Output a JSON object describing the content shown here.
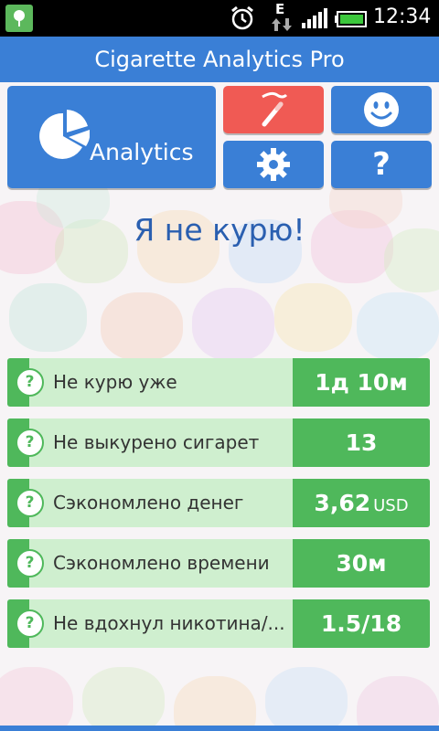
{
  "status_bar": {
    "time": "12:34",
    "network_type": "E",
    "icons": [
      "app-tree-icon",
      "alarm-clock-icon",
      "data-arrows-icon",
      "signal-icon",
      "battery-icon"
    ]
  },
  "app": {
    "title": "Cigarette Analytics Pro"
  },
  "toolbar": {
    "analytics_label": "Analytics",
    "help_label": "?"
  },
  "main": {
    "headline": "Я не курю!"
  },
  "stats": [
    {
      "label": "Не курю уже",
      "value": "1д 10м",
      "unit": ""
    },
    {
      "label": "Не выкурено сигарет",
      "value": "13",
      "unit": ""
    },
    {
      "label": "Сэкономлено денег",
      "value": "3,62",
      "unit": "USD"
    },
    {
      "label": "Сэкономлено времени",
      "value": "30м",
      "unit": ""
    },
    {
      "label": "Не вдохнул никотина/...",
      "value": "1.5/18",
      "unit": ""
    }
  ],
  "help_icon_text": "?",
  "colors": {
    "primary_blue": "#3a7fd6",
    "accent_red": "#f05a54",
    "green": "#4fb85b",
    "light_green": "#cfefcf",
    "headline_blue": "#2a5fb0"
  }
}
